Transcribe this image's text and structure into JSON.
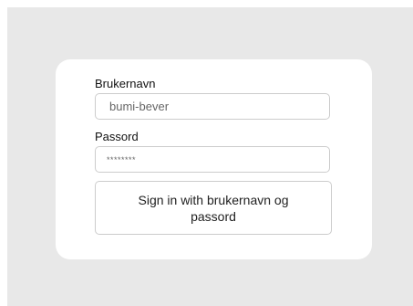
{
  "login": {
    "username_label": "Brukernavn",
    "username_value": "bumi-bever",
    "password_label": "Passord",
    "password_value": "********",
    "signin_button_label": "Sign in with brukernavn og passord"
  }
}
